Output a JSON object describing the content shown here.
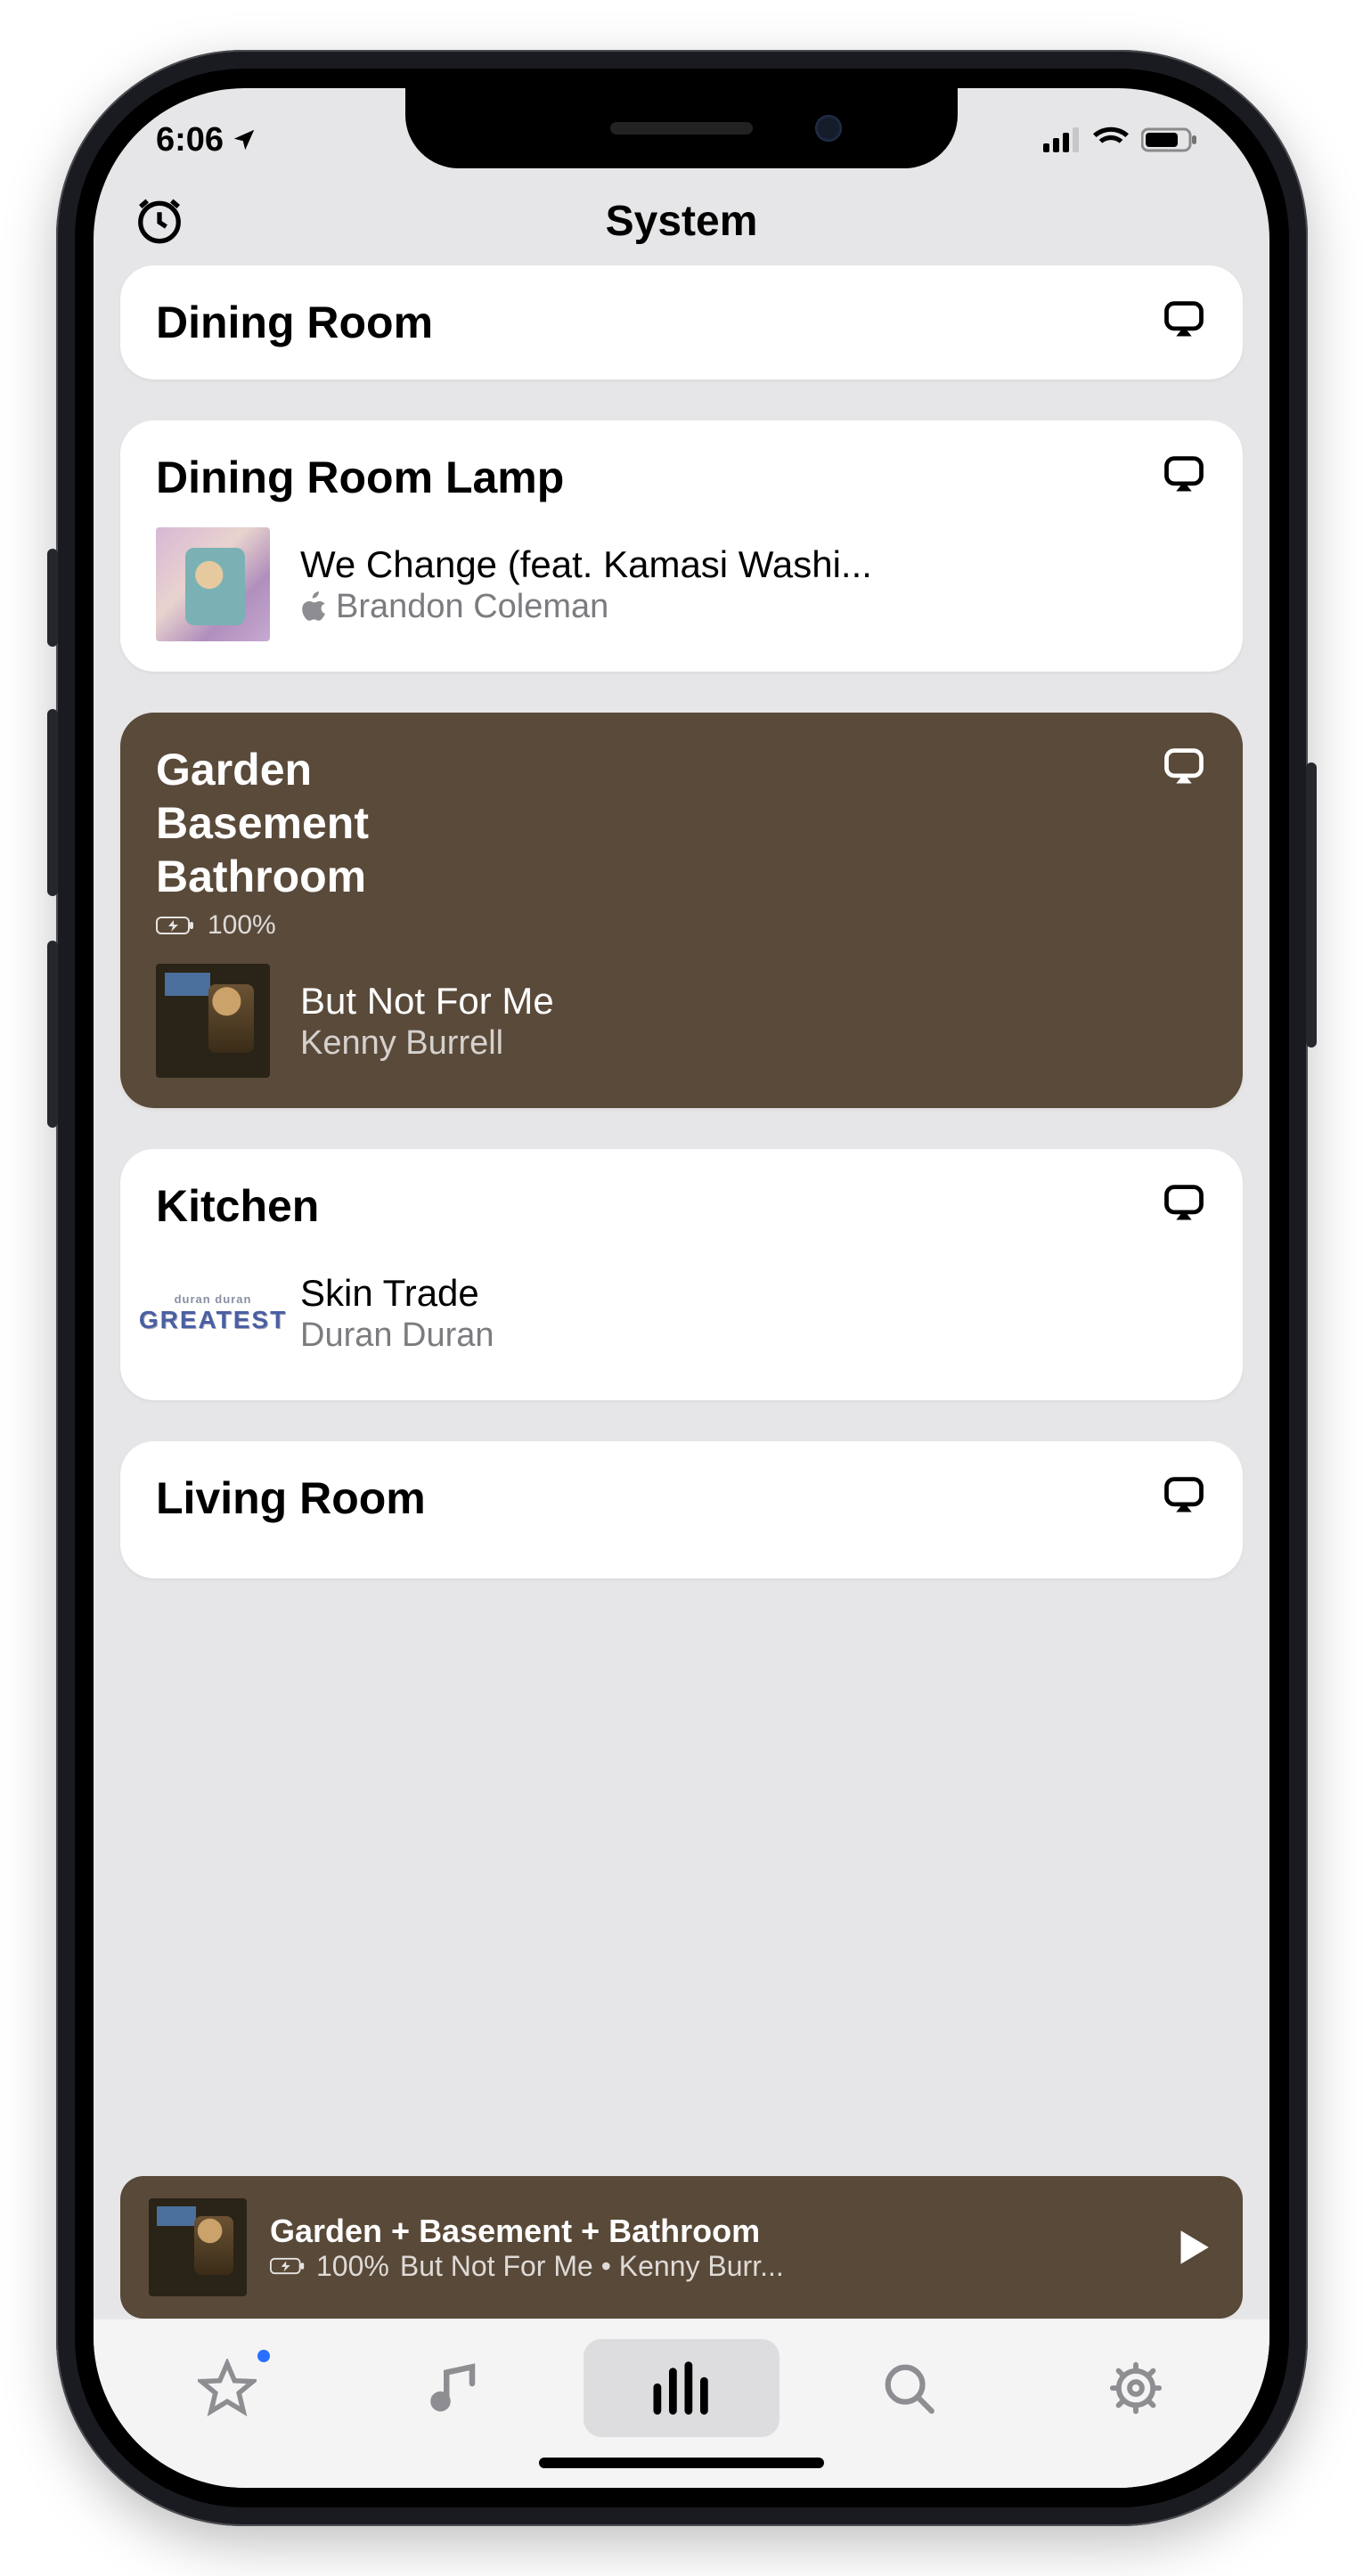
{
  "status": {
    "time": "6:06"
  },
  "nav": {
    "title": "System"
  },
  "rooms": [
    {
      "name": "Dining Room"
    },
    {
      "name": "Dining Room Lamp",
      "track": {
        "title": "We Change (feat. Kamasi Washi...",
        "artist": "Brandon Coleman",
        "source": "apple-music"
      }
    },
    {
      "nameLines": [
        "Garden",
        "Basement",
        "Bathroom"
      ],
      "battery": "100%",
      "selected": true,
      "track": {
        "title": "But Not For Me",
        "artist": "Kenny Burrell"
      }
    },
    {
      "name": "Kitchen",
      "track": {
        "title": "Skin Trade",
        "artist": "Duran Duran"
      }
    },
    {
      "name": "Living Room"
    }
  ],
  "mini": {
    "rooms": "Garden + Basement + Bathroom",
    "battery": "100%",
    "nowPlaying": "But Not For Me • Kenny Burr..."
  },
  "colors": {
    "selectedCard": "#5a4a3a",
    "miniPlayer": "#594938"
  }
}
